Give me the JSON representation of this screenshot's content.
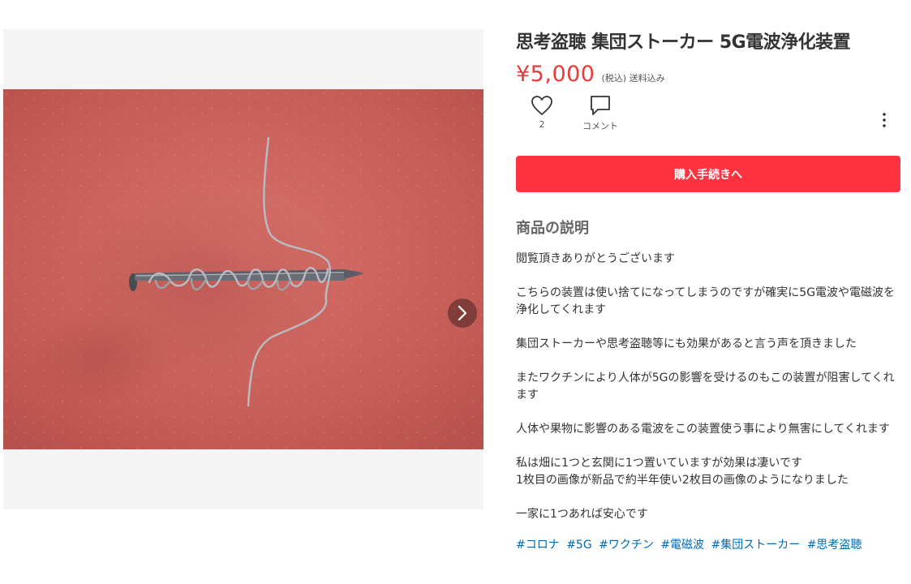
{
  "product": {
    "title": "思考盗聴 集団ストーカー 5G電波浄化装置",
    "price": "¥5,000",
    "price_note": "(税込) 送料込み",
    "photo_description": "赤いシート上の針金を巻き付けた釘",
    "like_count": "2",
    "comment_label": "コメント",
    "buy_button_label": "購入手続きへ",
    "description_heading": "商品の説明",
    "description": [
      "閲覧頂きありがとうございます",
      "こちらの装置は使い捨てになってしまうのですが確実に5G電波や電磁波を浄化してくれます",
      "集団ストーカーや思考盗聴等にも効果があると言う声を頂きました",
      "またワクチンにより人体が5Gの影響を受けるのもこの装置が阻害してくれます",
      "人体や果物に影響のある電波をこの装置使う事により無害にしてくれます",
      "私は畑に1つと玄関に1つ置いていますが効果は凄いです\n1枚目の画像が新品で約半年使い2枚目の画像のようになりました",
      "一家に1つあれば安心です"
    ],
    "tags": [
      "#コロナ",
      "#5G",
      "#ワクチン",
      "#電磁波",
      "#集団ストーカー",
      "#思考盗聴"
    ]
  },
  "icons": {
    "like": "heart-icon",
    "comment": "speech-bubble-icon",
    "more": "vertical-ellipsis-icon",
    "next": "chevron-right-icon"
  },
  "colors": {
    "price": "#e73c3c",
    "buy_button": "#ff333f",
    "tag_link": "#0069b4",
    "photo_background": "#c8605c"
  }
}
